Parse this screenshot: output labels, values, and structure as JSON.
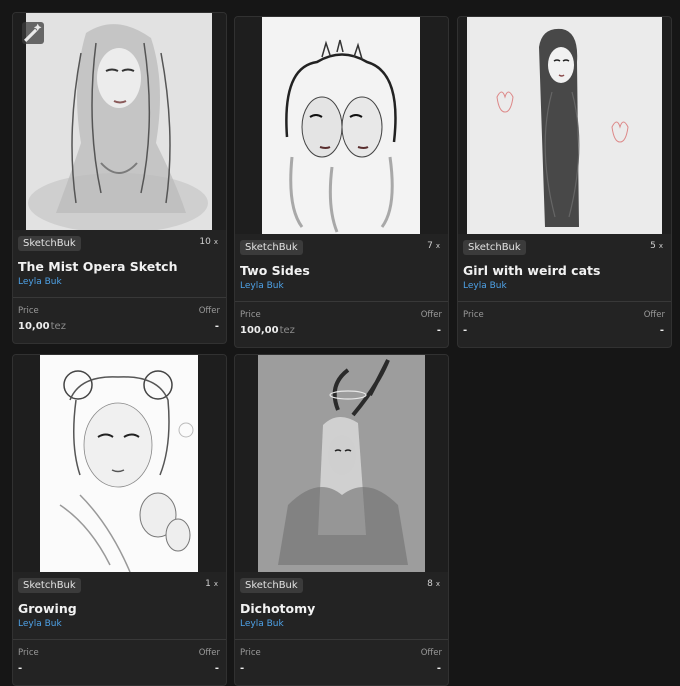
{
  "cards": [
    {
      "collection": "SketchBuk",
      "editions": "10",
      "editions_suffix": "x",
      "title": "The Mist Opera Sketch",
      "artist": "Leyla Buk",
      "price_label": "Price",
      "offer_label": "Offer",
      "price": "10,00",
      "price_unit": "tez",
      "offer": "-"
    },
    {
      "collection": "SketchBuk",
      "editions": "7",
      "editions_suffix": "x",
      "title": "Two Sides",
      "artist": "Leyla Buk",
      "price_label": "Price",
      "offer_label": "Offer",
      "price": "100,00",
      "price_unit": "tez",
      "offer": "-"
    },
    {
      "collection": "SketchBuk",
      "editions": "5",
      "editions_suffix": "x",
      "title": "Girl with weird cats",
      "artist": "Leyla Buk",
      "price_label": "Price",
      "offer_label": "Offer",
      "price": "-",
      "price_unit": "",
      "offer": "-"
    },
    {
      "collection": "SketchBuk",
      "editions": "1",
      "editions_suffix": "x",
      "title": "Growing",
      "artist": "Leyla Buk",
      "price_label": "Price",
      "offer_label": "Offer",
      "price": "-",
      "price_unit": "",
      "offer": "-"
    },
    {
      "collection": "SketchBuk",
      "editions": "8",
      "editions_suffix": "x",
      "title": "Dichotomy",
      "artist": "Leyla Buk",
      "price_label": "Price",
      "offer_label": "Offer",
      "price": "-",
      "price_unit": "",
      "offer": "-"
    }
  ],
  "icons": {
    "magic": "magic-wand-icon"
  },
  "colors": {
    "background": "#161616",
    "card": "#232323",
    "artist_link": "#4ea1e6"
  }
}
